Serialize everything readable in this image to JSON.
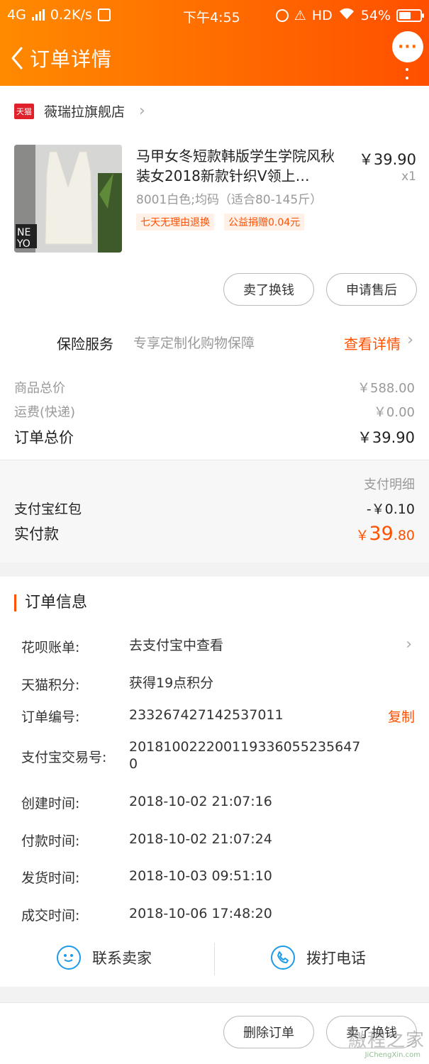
{
  "status_bar": {
    "network": "4G",
    "speed": "0.2K/s",
    "time": "下午4:55",
    "hd": "HD",
    "battery": "54%"
  },
  "nav": {
    "title": "订单详情",
    "more_label": "···"
  },
  "shop": {
    "badge": "天猫",
    "name": "薇瑞拉旗舰店"
  },
  "product": {
    "title": "马甲女冬短款韩版学生学院风秋装女2018新款针织V领上…",
    "price": "￥39.90",
    "qty": "x1",
    "sku": "8001白色;均码（适合80-145斤）",
    "tags": [
      "七天无理由退换",
      "公益捐赠0.04元"
    ],
    "image_text": "NE\nYO"
  },
  "actions": {
    "sell_exchange": "卖了换钱",
    "after_sale": "申请售后"
  },
  "insurance": {
    "title": "保险服务",
    "desc": "专享定制化购物保障",
    "link": "查看详情"
  },
  "costs": {
    "goods_label": "商品总价",
    "goods_value": "￥588.00",
    "shipping_label": "运费(快递)",
    "shipping_value": "￥0.00",
    "total_label": "订单总价",
    "total_value": "￥39.90"
  },
  "payment": {
    "detail_label": "支付明细",
    "redpacket_label": "支付宝红包",
    "redpacket_value": "-￥0.10",
    "paid_label": "实付款",
    "paid_currency": "￥",
    "paid_int": "39",
    "paid_dec": ".80"
  },
  "order_info": {
    "title": "订单信息",
    "huabei_label": "花呗账单:",
    "huabei_value": "去支付宝中查看",
    "points_label": "天猫积分:",
    "points_value": "获得19点积分",
    "order_no_label": "订单编号:",
    "order_no_value": "233267427142537011",
    "copy_label": "复制",
    "alipay_label": "支付宝交易号:",
    "alipay_value_line1": "201810022200119336055235647",
    "alipay_value_line2": "0",
    "created_label": "创建时间:",
    "created_value": "2018-10-02 21:07:16",
    "paid_label": "付款时间:",
    "paid_value": "2018-10-02 21:07:24",
    "shipped_label": "发货时间:",
    "shipped_value": "2018-10-03 09:51:10",
    "done_label": "成交时间:",
    "done_value": "2018-10-06 17:48:20"
  },
  "contact": {
    "seller": "联系卖家",
    "phone": "拨打电话"
  },
  "bottom": {
    "delete_order": "删除订单",
    "sell_exchange": "卖了换钱"
  },
  "watermark": {
    "main": "繳程之家",
    "sub": "JiChengXin.com"
  },
  "colors": {
    "accent": "#ff5000",
    "header_start": "#ff8a00",
    "header_end": "#ff4f00",
    "icon_blue": "#1e9be8"
  }
}
